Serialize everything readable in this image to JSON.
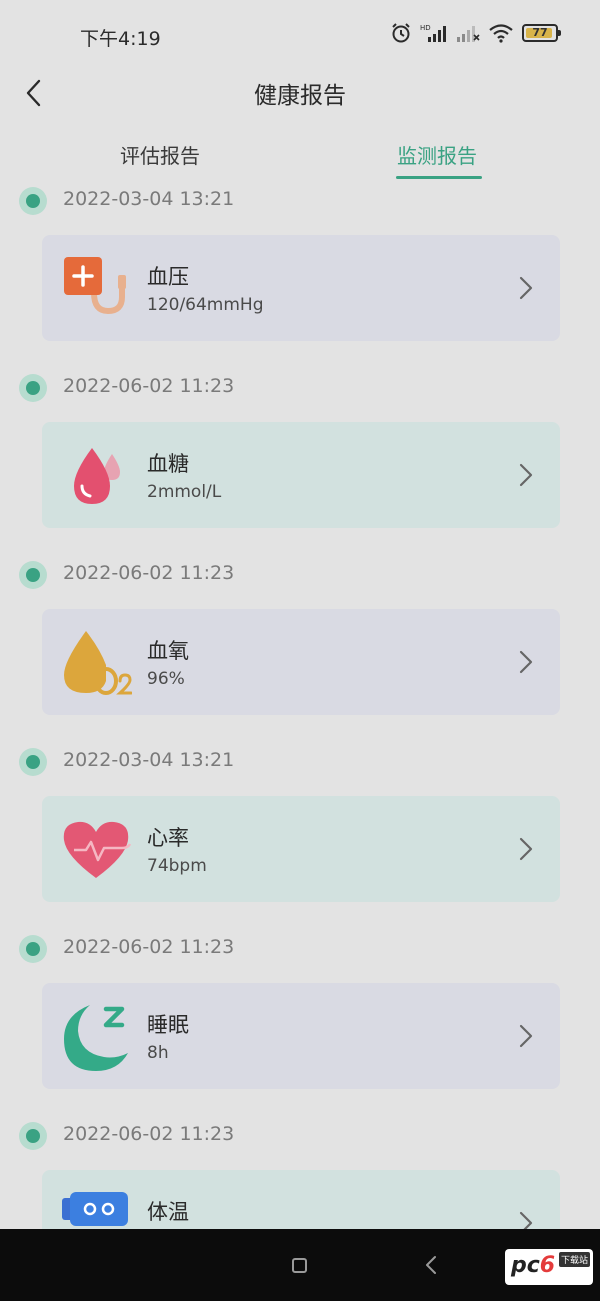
{
  "status_bar": {
    "time": "下午4:19",
    "battery": "77"
  },
  "header": {
    "title": "健康报告"
  },
  "tabs": [
    {
      "label": "评估报告",
      "active": false
    },
    {
      "label": "监测报告",
      "active": true
    }
  ],
  "entries": [
    {
      "timestamp": "2022-03-04 13:21",
      "title": "血压",
      "value": "120/64mmHg",
      "icon": "blood-pressure-icon"
    },
    {
      "timestamp": "2022-06-02 11:23",
      "title": "血糖",
      "value": "2mmol/L",
      "icon": "blood-sugar-icon"
    },
    {
      "timestamp": "2022-06-02 11:23",
      "title": "血氧",
      "value": "96%",
      "icon": "blood-oxygen-icon"
    },
    {
      "timestamp": "2022-03-04 13:21",
      "title": "心率",
      "value": "74bpm",
      "icon": "heart-rate-icon"
    },
    {
      "timestamp": "2022-06-02 11:23",
      "title": "睡眠",
      "value": "8h",
      "icon": "sleep-icon"
    },
    {
      "timestamp": "2022-06-02 11:23",
      "title": "体温",
      "value": "",
      "icon": "temperature-icon"
    }
  ],
  "watermark": {
    "brand_a": "pc",
    "brand_b": "6",
    "sub": "下载站"
  },
  "colors": {
    "accent": "#3aa283",
    "card_purple": "#d9dae3",
    "card_green": "#d2e1df"
  }
}
